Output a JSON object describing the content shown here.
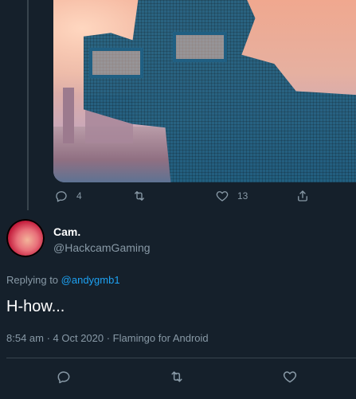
{
  "previous_tweet": {
    "actions": {
      "reply_count": "4",
      "like_count": "13"
    }
  },
  "tweet": {
    "author_name": "Cam.",
    "author_handle": "@HackcamGaming",
    "replying_prefix": "Replying to",
    "replying_handle": "@andygmb1",
    "text": "H-how...",
    "timestamp": "8:54 am · 4 Oct 2020 · Flamingo for Android"
  },
  "icons": [
    "reply-icon",
    "retweet-icon",
    "like-icon",
    "share-icon"
  ],
  "colors": {
    "background": "#15202b",
    "text_primary": "#ffffff",
    "text_secondary": "#8899a6",
    "link": "#1da1f2",
    "divider": "#38444d"
  }
}
